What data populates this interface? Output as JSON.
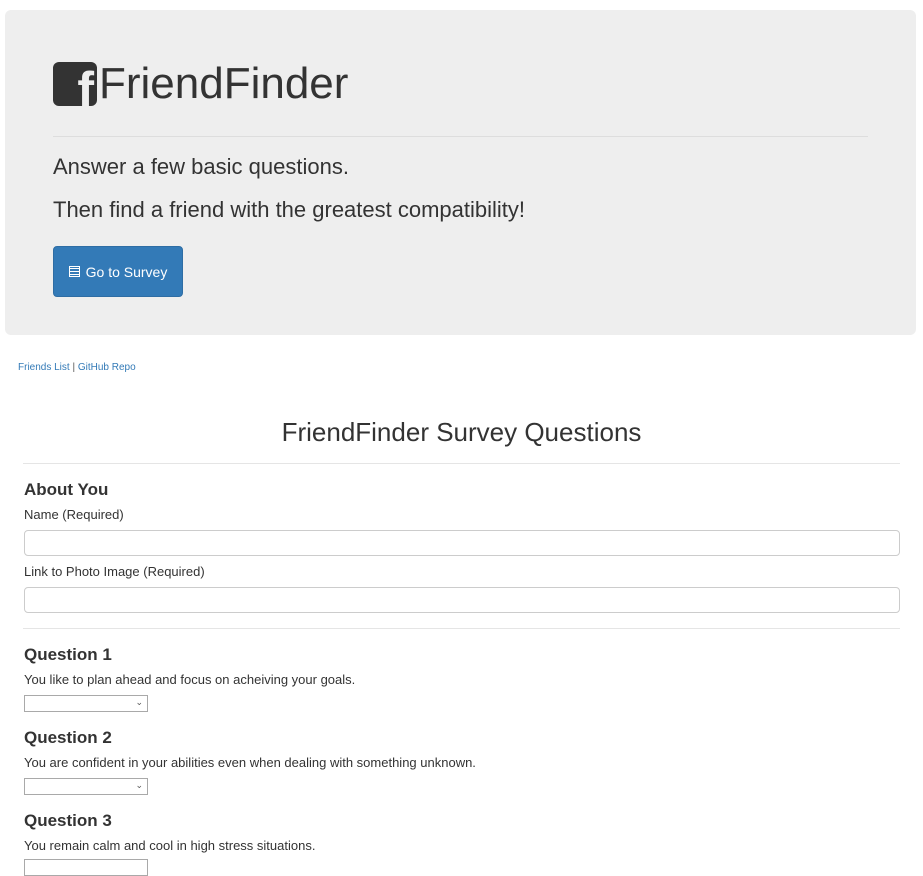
{
  "jumbotron": {
    "brand_icon_glyph": "f",
    "brand_icon": "facebook-icon",
    "title": "FriendFinder",
    "lead_line_1": "Answer a few basic questions.",
    "lead_line_2": "Then find a friend with the greatest compatibility!",
    "button_label": "Go to Survey",
    "button_icon": "list-alt-icon",
    "button_color": "#337ab7"
  },
  "links": {
    "friends_list": "Friends List",
    "separator": " | ",
    "github_repo": "GitHub Repo"
  },
  "survey": {
    "title": "FriendFinder Survey Questions",
    "about": {
      "heading": "About You",
      "name_label": "Name (Required)",
      "name_value": "",
      "photo_label": "Link to Photo Image (Required)",
      "photo_value": ""
    },
    "questions": [
      {
        "heading": "Question 1",
        "text": "You like to plan ahead and focus on acheiving your goals.",
        "selected": ""
      },
      {
        "heading": "Question 2",
        "text": "You are confident in your abilities even when dealing with something unknown.",
        "selected": ""
      },
      {
        "heading": "Question 3",
        "text": "You remain calm and cool in high stress situations.",
        "selected": ""
      }
    ]
  }
}
